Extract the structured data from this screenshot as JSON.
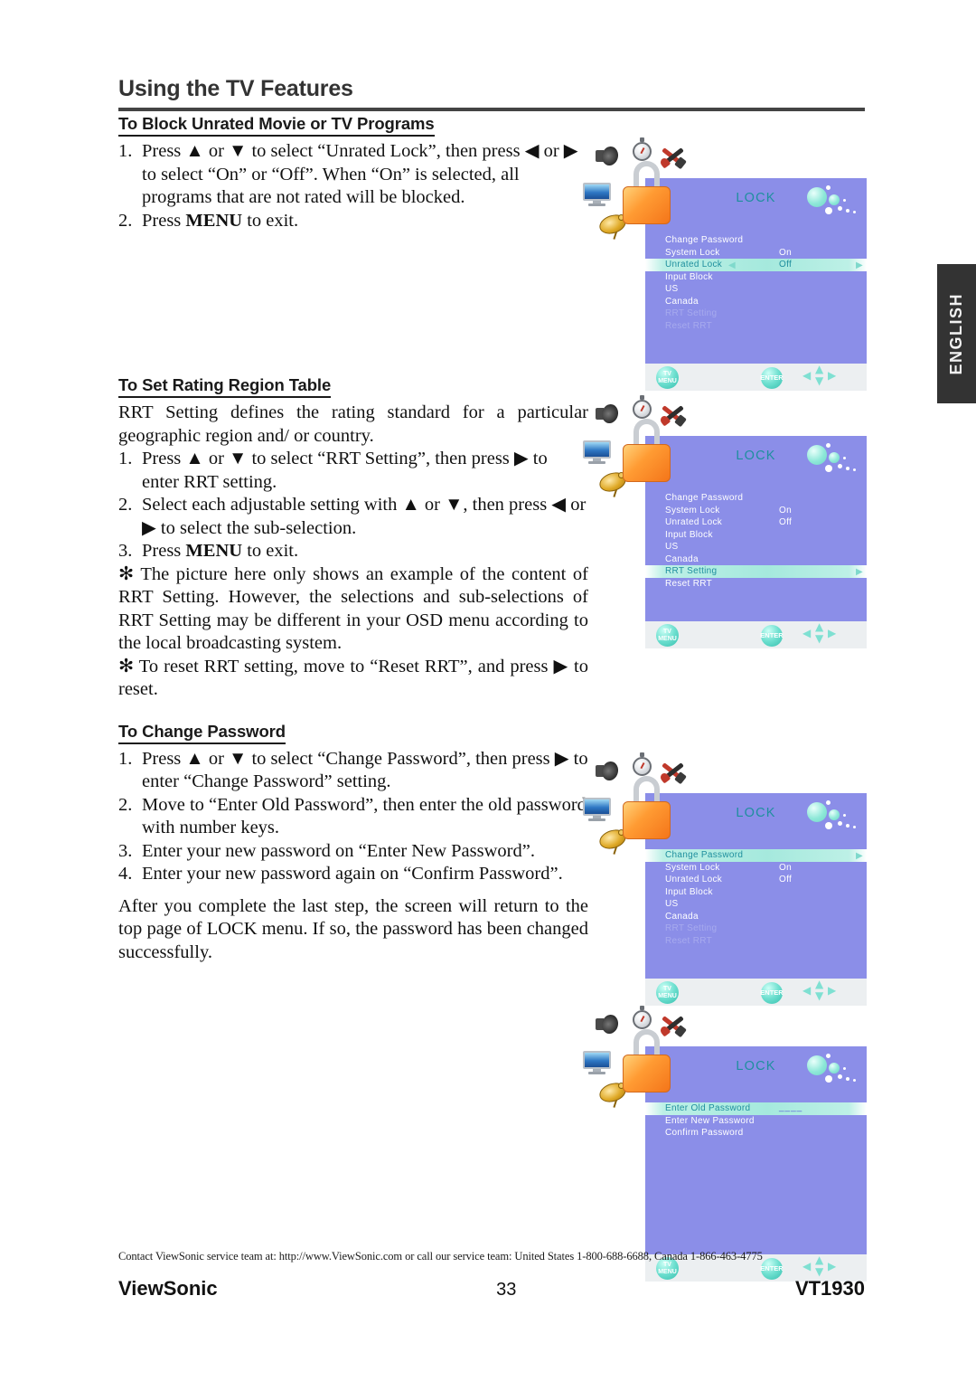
{
  "header": {
    "title": "Using the TV Features"
  },
  "language_tab": {
    "label": "ENGLISH"
  },
  "sections": [
    {
      "heading": "To Block Unrated Movie or TV Programs",
      "steps": [
        {
          "num": "1.",
          "text": "Press ▲ or ▼ to select “Unrated Lock”, then press ◀ or ▶ to select “On” or “Off”. When “On” is selected, all programs that are not rated will be blocked."
        },
        {
          "num": "2.",
          "pre": "Press ",
          "kw": "MENU",
          "post": " to exit."
        }
      ]
    },
    {
      "heading": "To Set Rating Region Table",
      "intro": "RRT Setting defines the rating standard for a particular geographic region and/ or country.",
      "steps": [
        {
          "num": "1.",
          "text": "Press ▲ or ▼ to select “RRT Setting”, then press ▶ to enter RRT setting."
        },
        {
          "num": "2.",
          "text": "Select each adjustable setting with ▲ or ▼, then press ◀ or ▶ to select the sub-selection."
        },
        {
          "num": "3.",
          "pre": "Press ",
          "kw": "MENU",
          "post": " to exit."
        }
      ],
      "notes": [
        "✻ The picture here only shows an example of the content of RRT Setting. However, the selections and sub-selections of RRT Setting may be different in your OSD menu according to the local broadcasting system.",
        "✻ To reset RRT setting, move to “Reset RRT”, and press ▶ to reset."
      ]
    },
    {
      "heading": "To Change Password",
      "steps": [
        {
          "num": "1.",
          "text": "Press ▲ or ▼ to select “Change Password”, then press ▶ to enter “Change Password” setting."
        },
        {
          "num": "2.",
          "text": "Move to “Enter Old Password”, then enter the old password with number keys."
        },
        {
          "num": "3.",
          "text": "Enter your new password on “Enter New Password”."
        },
        {
          "num": "4.",
          "text": "Enter your new password again on “Confirm Password”."
        }
      ],
      "closing": "After you complete the last step, the screen will return to the top page of LOCK menu. If so, the password has been changed successfully."
    }
  ],
  "osd_common": {
    "title": "LOCK",
    "buttons": {
      "tv_menu_line1": "TV",
      "tv_menu_line2": "MENU",
      "enter": "ENTER",
      "arrow_up": "▲",
      "arrow_down": "▼",
      "arrow_left": "◀",
      "arrow_right": "▶"
    },
    "indicator_left": "◀",
    "indicator_right": "▶",
    "icons": [
      "speaker-icon",
      "stopwatch-icon",
      "tools-icon",
      "monitor-icon",
      "satellite-dish-icon",
      "padlock-icon"
    ],
    "colors": {
      "screen_bg": "#8b8ee8",
      "title_text": "#1f8f9e",
      "item_text": "#ffffff",
      "item_dim": "#a7aaee",
      "highlight": "#a5e9dd",
      "bottom_bar": "#eceff1",
      "lock_body": "#ff9b33"
    }
  },
  "osd_panels": [
    {
      "name": "unrated-lock",
      "rows": [
        {
          "label": "Change Password",
          "value": "",
          "state": "normal"
        },
        {
          "label": "System Lock",
          "value": "On",
          "state": "normal"
        },
        {
          "label": "Unrated Lock",
          "value": "Off",
          "state": "selected"
        },
        {
          "label": "Input Block",
          "value": "",
          "state": "normal"
        },
        {
          "label": "US",
          "value": "",
          "state": "normal"
        },
        {
          "label": "Canada",
          "value": "",
          "state": "normal"
        },
        {
          "label": "RRT Setting",
          "value": "",
          "state": "dim"
        },
        {
          "label": "Reset RRT",
          "value": "",
          "state": "dim"
        }
      ]
    },
    {
      "name": "rrt-setting",
      "rows": [
        {
          "label": "Change Password",
          "value": "",
          "state": "normal"
        },
        {
          "label": "System Lock",
          "value": "On",
          "state": "normal"
        },
        {
          "label": "Unrated Lock",
          "value": "Off",
          "state": "normal"
        },
        {
          "label": "Input Block",
          "value": "",
          "state": "normal"
        },
        {
          "label": "US",
          "value": "",
          "state": "normal"
        },
        {
          "label": "Canada",
          "value": "",
          "state": "normal"
        },
        {
          "label": "RRT Setting",
          "value": "",
          "state": "selected"
        },
        {
          "label": "Reset RRT",
          "value": "",
          "state": "normal"
        }
      ]
    },
    {
      "name": "change-password",
      "rows": [
        {
          "label": "Change Password",
          "value": "",
          "state": "selected"
        },
        {
          "label": "System Lock",
          "value": "On",
          "state": "normal"
        },
        {
          "label": "Unrated Lock",
          "value": "Off",
          "state": "normal"
        },
        {
          "label": "Input Block",
          "value": "",
          "state": "normal"
        },
        {
          "label": "US",
          "value": "",
          "state": "normal"
        },
        {
          "label": "Canada",
          "value": "",
          "state": "normal"
        },
        {
          "label": "RRT Setting",
          "value": "",
          "state": "dim"
        },
        {
          "label": "Reset RRT",
          "value": "",
          "state": "dim"
        }
      ]
    },
    {
      "name": "password-entry",
      "rows": [
        {
          "label": "Enter Old Password",
          "value": "____",
          "state": "selected"
        },
        {
          "label": "Enter New Password",
          "value": "",
          "state": "normal"
        },
        {
          "label": "Confirm Password",
          "value": "",
          "state": "normal"
        }
      ]
    }
  ],
  "footer": {
    "contact": "Contact ViewSonic service team at: http://www.ViewSonic.com or call our service team: United States 1-800-688-6688, Canada 1-866-463-4775",
    "brand": "ViewSonic",
    "page_number": "33",
    "model": "VT1930"
  }
}
